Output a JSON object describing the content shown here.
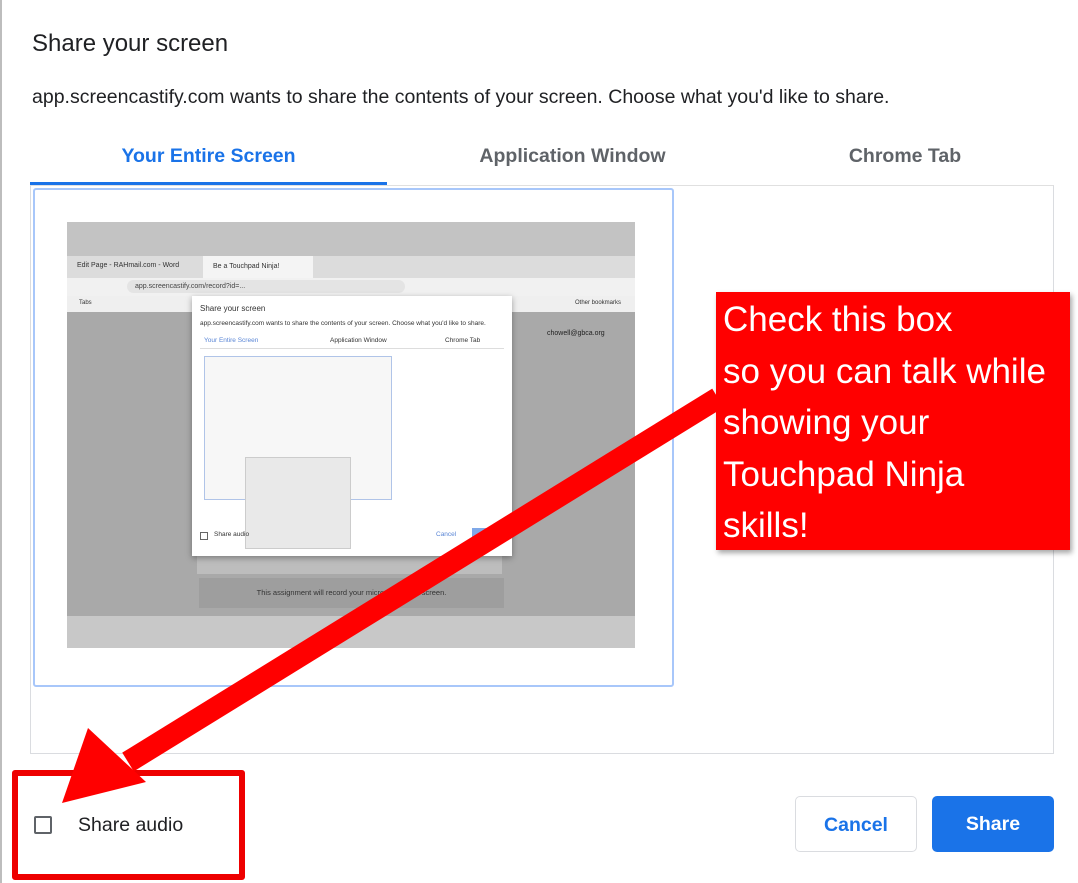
{
  "dialog": {
    "title": "Share your screen",
    "subtitle": "app.screencastify.com wants to share the contents of your screen. Choose what you'd like to share."
  },
  "tabs": [
    {
      "label": "Your Entire Screen",
      "active": true
    },
    {
      "label": "Application Window",
      "active": false
    },
    {
      "label": "Chrome Tab",
      "active": false
    }
  ],
  "preview": {
    "tab1_label": "Edit Page - RAHmail.com - Word",
    "tab2_label": "Be a Touchpad Ninja!",
    "url": "app.screencastify.com/record?id=...",
    "bookmarks_left": "Tabs",
    "bookmarks_right": "Other bookmarks",
    "email": "chowell@gbca.org",
    "footer_text": "This assignment will record your microphone and screen.",
    "inner_dialog": {
      "title": "Share your screen",
      "subtitle": "app.screencastify.com wants to share the contents of your screen. Choose what you'd like to share.",
      "tabs": [
        "Your Entire Screen",
        "Application Window",
        "Chrome Tab"
      ],
      "share_audio": "Share audio",
      "cancel": "Cancel"
    }
  },
  "footer": {
    "share_audio_label": "Share audio",
    "share_audio_checked": false,
    "cancel_label": "Cancel",
    "share_label": "Share"
  },
  "annotation": {
    "text": "Check this box\nso you can talk while\nshowing your\nTouchpad Ninja\nskills!",
    "color": "#ff0000"
  },
  "colors": {
    "accent": "#1a73e8",
    "annotation_red": "#ff0000"
  }
}
